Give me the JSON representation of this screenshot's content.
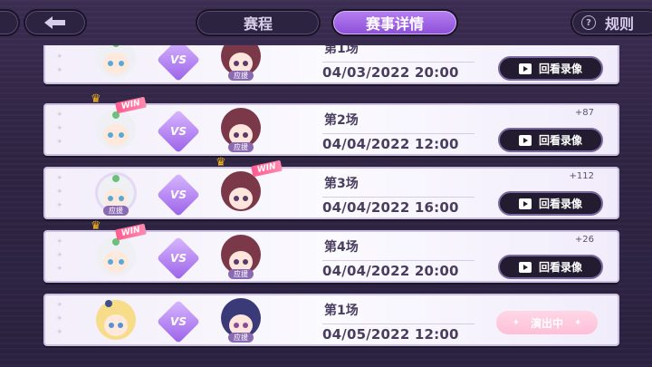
{
  "header": {
    "back_icon": "arrow-left-icon",
    "tabs": [
      {
        "label": "赛程",
        "active": false
      },
      {
        "label": "赛事详情",
        "active": true
      }
    ],
    "rules_label": "规则",
    "rules_icon": "question-mark-icon",
    "accent_color": "#9d62e6"
  },
  "matches": [
    {
      "match_no": "第1场",
      "time": "04/03/2022 20:00",
      "score": "",
      "action": "回看录像",
      "left_win": false,
      "right_win": false,
      "cheer": "right",
      "cheer_label": "应援"
    },
    {
      "match_no": "第2场",
      "time": "04/04/2022 12:00",
      "score": "+87",
      "action": "回看录像",
      "left_win": true,
      "right_win": false,
      "cheer": "right",
      "cheer_label": "应援"
    },
    {
      "match_no": "第3场",
      "time": "04/04/2022 16:00",
      "score": "+112",
      "action": "回看录像",
      "left_win": false,
      "right_win": true,
      "cheer": "left",
      "cheer_label": "应援"
    },
    {
      "match_no": "第4场",
      "time": "04/04/2022 20:00",
      "score": "+26",
      "action": "回看录像",
      "left_win": true,
      "right_win": false,
      "cheer": "right",
      "cheer_label": "应援"
    },
    {
      "match_no": "第1场",
      "time": "04/05/2022 12:00",
      "score": "",
      "action": "演出中",
      "left_win": false,
      "right_win": false,
      "cheer": "right",
      "cheer_label": "应援"
    }
  ],
  "vs_label": "VS",
  "win_label": "WIN"
}
